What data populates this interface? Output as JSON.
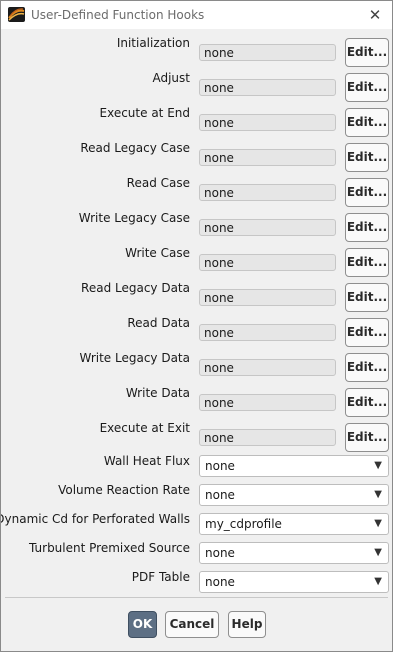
{
  "window": {
    "title": "User-Defined Function Hooks"
  },
  "hooks": [
    {
      "label": "Initialization",
      "value": "none",
      "edit_label": "Edit..."
    },
    {
      "label": "Adjust",
      "value": "none",
      "edit_label": "Edit..."
    },
    {
      "label": "Execute at End",
      "value": "none",
      "edit_label": "Edit..."
    },
    {
      "label": "Read Legacy Case",
      "value": "none",
      "edit_label": "Edit..."
    },
    {
      "label": "Read Case",
      "value": "none",
      "edit_label": "Edit..."
    },
    {
      "label": "Write Legacy Case",
      "value": "none",
      "edit_label": "Edit..."
    },
    {
      "label": "Write Case",
      "value": "none",
      "edit_label": "Edit..."
    },
    {
      "label": "Read Legacy Data",
      "value": "none",
      "edit_label": "Edit..."
    },
    {
      "label": "Read Data",
      "value": "none",
      "edit_label": "Edit..."
    },
    {
      "label": "Write Legacy Data",
      "value": "none",
      "edit_label": "Edit..."
    },
    {
      "label": "Write Data",
      "value": "none",
      "edit_label": "Edit..."
    },
    {
      "label": "Execute at Exit",
      "value": "none",
      "edit_label": "Edit..."
    }
  ],
  "dropdowns": [
    {
      "label": "Wall Heat Flux",
      "value": "none"
    },
    {
      "label": "Volume Reaction Rate",
      "value": "none"
    },
    {
      "label": "Dynamic Cd for Perforated Walls",
      "value": "my_cdprofile"
    },
    {
      "label": "Turbulent Premixed Source",
      "value": "none"
    },
    {
      "label": "PDF Table",
      "value": "none"
    }
  ],
  "buttons": {
    "ok": "OK",
    "cancel": "Cancel",
    "help": "Help"
  },
  "colors": {
    "ok_button": "#5d6f84",
    "field_bg": "#e6e6e6",
    "dialog_bg": "#f0f0f0"
  },
  "icons": {
    "app": "fluent-app-icon",
    "close": "close-icon",
    "dropdown": "chevron-down-icon"
  }
}
